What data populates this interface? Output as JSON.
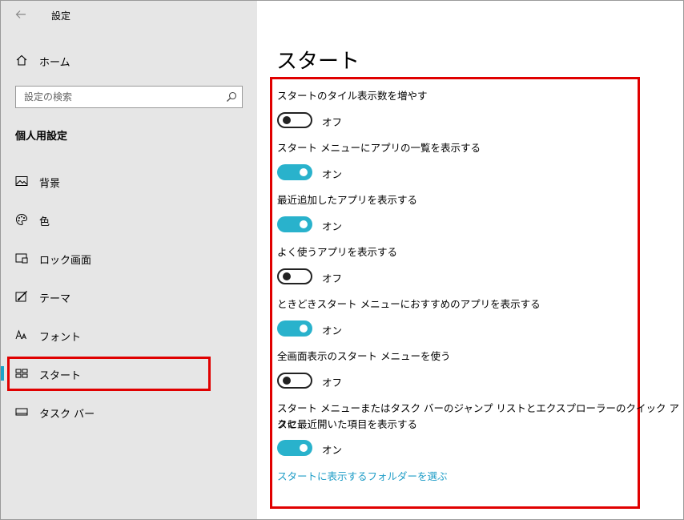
{
  "window": {
    "title": "設定"
  },
  "sidebar": {
    "home_label": "ホーム",
    "search_placeholder": "設定の検索",
    "section_title": "個人用設定",
    "items": [
      {
        "label": "背景",
        "icon": "image-icon"
      },
      {
        "label": "色",
        "icon": "palette-icon"
      },
      {
        "label": "ロック画面",
        "icon": "lock-screen-icon"
      },
      {
        "label": "テーマ",
        "icon": "theme-icon"
      },
      {
        "label": "フォント",
        "icon": "font-icon"
      },
      {
        "label": "スタート",
        "icon": "start-icon",
        "active": true
      },
      {
        "label": "タスク バー",
        "icon": "taskbar-icon"
      }
    ]
  },
  "main": {
    "title": "スタート",
    "settings": [
      {
        "label": "スタートのタイル表示数を増やす",
        "state": "オフ",
        "on": false
      },
      {
        "label": "スタート メニューにアプリの一覧を表示する",
        "state": "オン",
        "on": true
      },
      {
        "label": "最近追加したアプリを表示する",
        "state": "オン",
        "on": true
      },
      {
        "label": "よく使うアプリを表示する",
        "state": "オフ",
        "on": false
      },
      {
        "label": "ときどきスタート メニューにおすすめのアプリを表示する",
        "state": "オン",
        "on": true
      },
      {
        "label": "全画面表示のスタート メニューを使う",
        "state": "オフ",
        "on": false
      },
      {
        "label_line1": "スタート メニューまたはタスク バーのジャンプ リストとエクスプローラーのクイック アクセ",
        "label_line2": "スに最近開いた項目を表示する",
        "state": "オン",
        "on": true
      }
    ],
    "folders_link": "スタートに表示するフォルダーを選ぶ"
  },
  "colors": {
    "accent": "#29b2cc",
    "link": "#1f9dc7",
    "highlight": "#e00000",
    "sidebar_bg": "#e6e6e6"
  }
}
